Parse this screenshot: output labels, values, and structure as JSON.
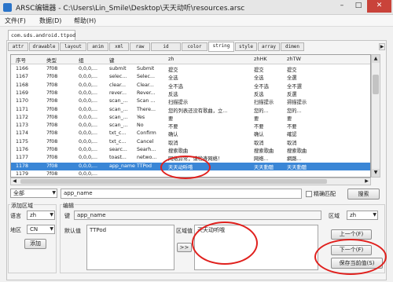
{
  "window": {
    "title": "ARSC编辑器 - C:\\Users\\Lin_Smile\\Desktop\\天天动听\\resources.arsc",
    "controls": {
      "minimize": "–",
      "maximize": "□",
      "close": "✕"
    }
  },
  "menu": {
    "file": "文件(F)",
    "data": "数据(D)",
    "help": "帮助(H)"
  },
  "package_tab": "com.sds.android.ttpod",
  "resource_tabs": [
    "attr",
    "drawable",
    "layout",
    "anim",
    "xml",
    "raw",
    "id",
    "color",
    "string",
    "style",
    "array",
    "dimen"
  ],
  "active_tab": "string",
  "table": {
    "columns": [
      "序号",
      "类型",
      "组",
      "键",
      "zh",
      "zhHK",
      "zhTW"
    ],
    "rows": [
      {
        "index": "1166",
        "type": "7f08",
        "group": "0,0,0,...",
        "key": "submit",
        "default": "Submit",
        "zh": "提交",
        "zhHK": "提交",
        "zhTW": "提交"
      },
      {
        "index": "1167",
        "type": "7f08",
        "group": "0,0,0,...",
        "key": "selec...",
        "default": "Selec...",
        "zh": "全选",
        "zhHK": "全选",
        "zhTW": "全選"
      },
      {
        "index": "1168",
        "type": "7f08",
        "group": "0,0,0,...",
        "key": "clear...",
        "default": "Clear...",
        "zh": "全不选",
        "zhHK": "全不选",
        "zhTW": "全不選"
      },
      {
        "index": "1169",
        "type": "7f08",
        "group": "0,0,0,...",
        "key": "rever...",
        "default": "Rever...",
        "zh": "反选",
        "zhHK": "反选",
        "zhTW": "反選"
      },
      {
        "index": "1170",
        "type": "7f08",
        "group": "0,0,0,...",
        "key": "scan_...",
        "default": "Scan ...",
        "zh": "扫描提示",
        "zhHK": "扫描提示",
        "zhTW": "掃描提示"
      },
      {
        "index": "1171",
        "type": "7f08",
        "group": "0,0,0,...",
        "key": "scan_...",
        "default": "There...",
        "zh": "您的列表还没有歌曲，立...",
        "zhHK": "您的...",
        "zhTW": "您的..."
      },
      {
        "index": "1172",
        "type": "7f08",
        "group": "0,0,0,...",
        "key": "scan_...",
        "default": "Yes",
        "zh": "要",
        "zhHK": "要",
        "zhTW": "要"
      },
      {
        "index": "1173",
        "type": "7f08",
        "group": "0,0,0,...",
        "key": "scan_...",
        "default": "No",
        "zh": "不要",
        "zhHK": "不要",
        "zhTW": "不要"
      },
      {
        "index": "1174",
        "type": "7f08",
        "group": "0,0,0,...",
        "key": "txt_c...",
        "default": "Confirm",
        "zh": "确认",
        "zhHK": "确认",
        "zhTW": "確認"
      },
      {
        "index": "1175",
        "type": "7f08",
        "group": "0,0,0,...",
        "key": "txt_c...",
        "default": "Cancel",
        "zh": "取消",
        "zhHK": "取消",
        "zhTW": "取消"
      },
      {
        "index": "1176",
        "type": "7f08",
        "group": "0,0,0,...",
        "key": "searc...",
        "default": "Searh...",
        "zh": "搜索歌曲",
        "zhHK": "搜索歌曲",
        "zhTW": "搜索歌曲"
      },
      {
        "index": "1177",
        "type": "7f08",
        "group": "0,0,0,...",
        "key": "toast...",
        "default": "netwo...",
        "zh": "网络异常，请检查网络！",
        "zhHK": "网络...",
        "zhTW": "網路..."
      },
      {
        "index": "1178",
        "type": "7f08",
        "group": "0,0,0,...",
        "key": "app_name",
        "default": "TTPod",
        "zh": "天天动听哦",
        "zhHK": "天天動聽",
        "zhTW": "天天動聽"
      },
      {
        "index": "1179",
        "type": "7f08",
        "group": "0,0,0,...",
        "key": "",
        "default": "",
        "zh": "",
        "zhHK": "",
        "zhTW": ""
      }
    ],
    "selected_index": "1178"
  },
  "search": {
    "scope_label": "全部",
    "query": "app_name",
    "exact_match_label": "精确匹配",
    "search_button": "搜索"
  },
  "add_area": {
    "title": "添加区域",
    "language_label": "语言",
    "language_value": "zh",
    "region_label": "地区",
    "region_value": "CN",
    "add_button": "添加"
  },
  "editor": {
    "title": "编辑",
    "key_label": "键",
    "key_value": "app_name",
    "region_label": "区域",
    "region_value": "zh",
    "default_label": "默认值",
    "default_value": "TTPod",
    "region_value_label": "区域值",
    "region_value_text": "天天动听哦",
    "copy_button": ">>",
    "prev_button": "上一个(F)",
    "next_button": "下一个(F)",
    "save_button": "保存当前值(S)"
  },
  "scroll": {
    "up": "▲",
    "down": "▼",
    "left": "◀",
    "right": "▶"
  },
  "colors": {
    "selection": "#3a86d6",
    "highlight_ring": "#e0201d",
    "close": "#c9433a"
  }
}
